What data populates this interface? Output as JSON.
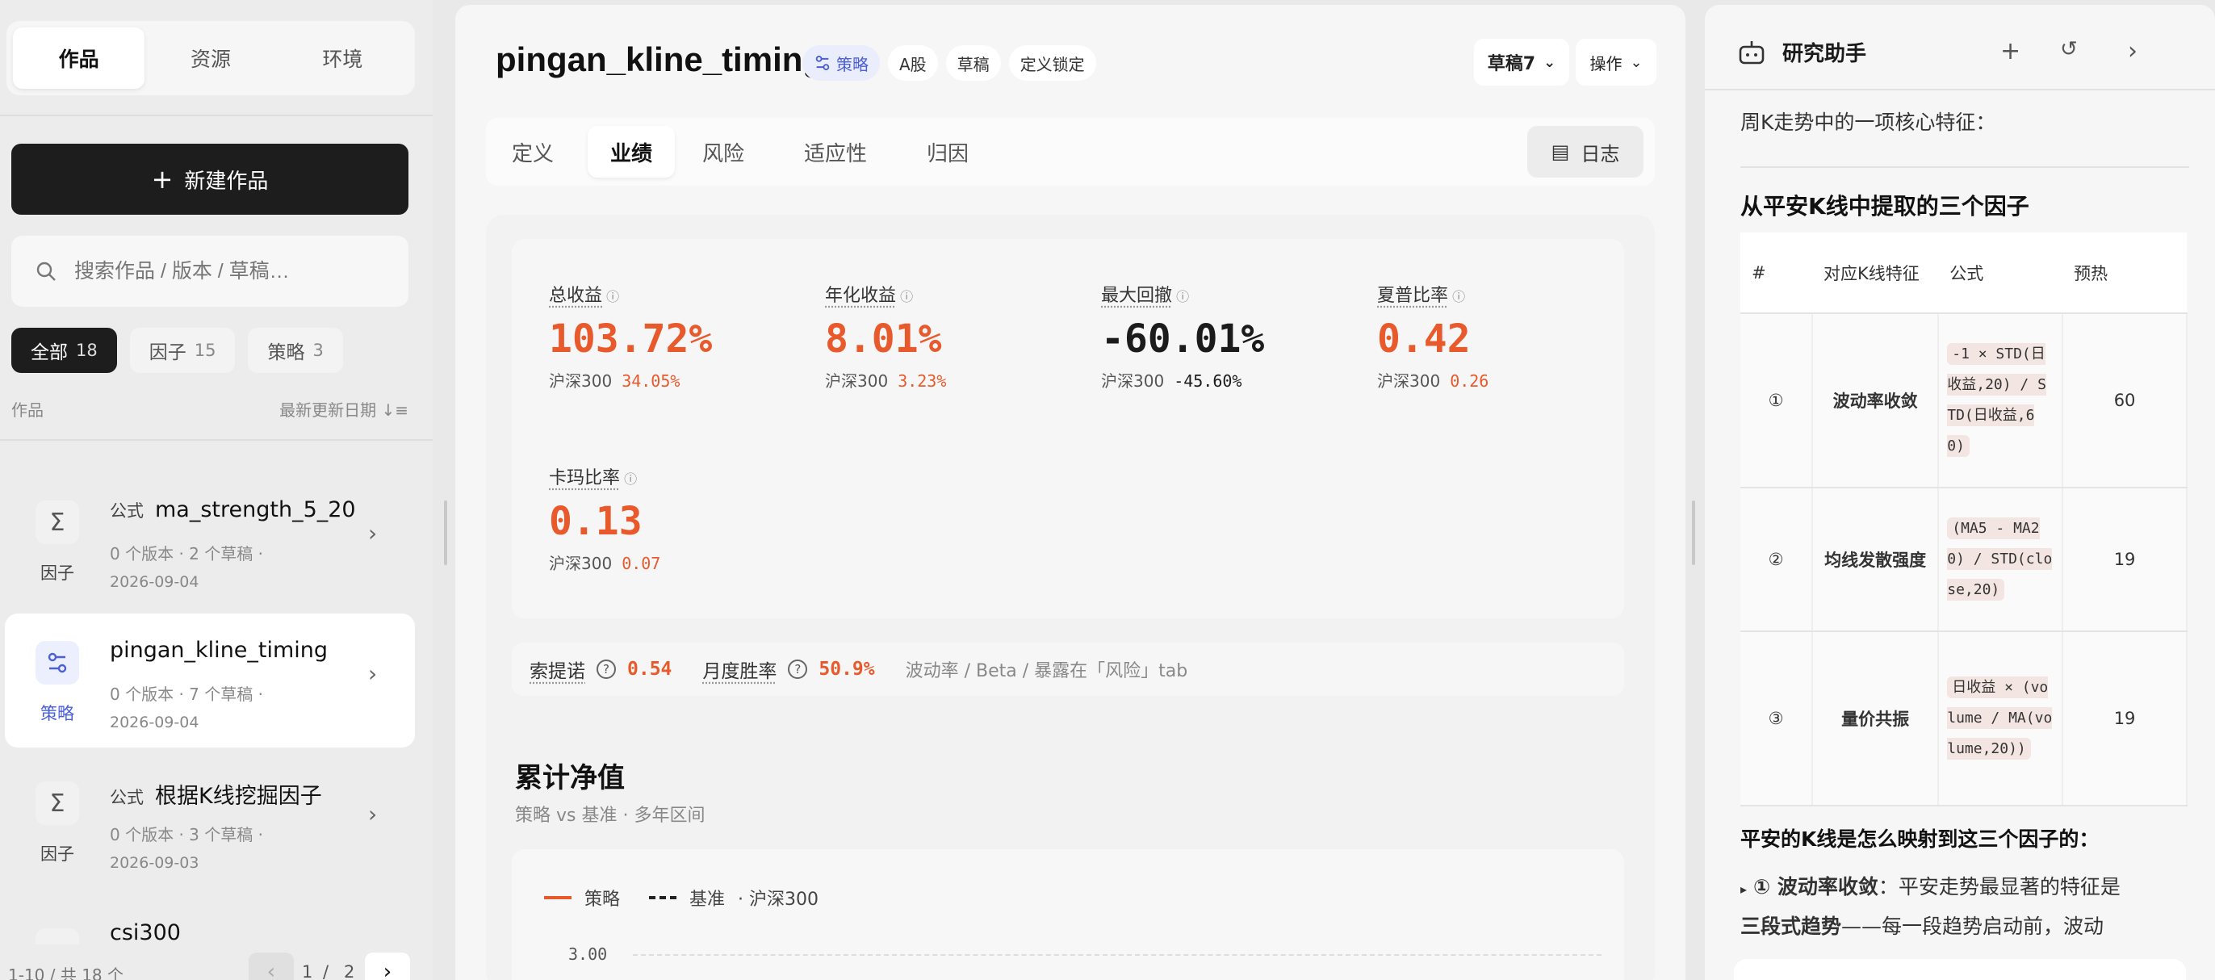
{
  "sidebar": {
    "tabs": [
      "作品",
      "资源",
      "环境"
    ],
    "new_button": "新建作品",
    "search_placeholder": "搜索作品 / 版本 / 草稿…",
    "filters": [
      {
        "label": "全部",
        "count": "18"
      },
      {
        "label": "因子",
        "count": "15"
      },
      {
        "label": "策略",
        "count": "3"
      }
    ],
    "list_header_left": "作品",
    "list_header_right": "最新更新日期",
    "items": [
      {
        "kind": "因子",
        "tag": "公式",
        "title": "ma_strength_5_20",
        "meta": "0 个版本 · 2 个草稿 ·",
        "date": "2026-09-04",
        "icon": "sigma-icon"
      },
      {
        "kind": "策略",
        "tag": "",
        "title": "pingan_kline_timing",
        "meta": "0 个版本 · 7 个草稿 ·",
        "date": "2026-09-04",
        "icon": "strategy-icon"
      },
      {
        "kind": "因子",
        "tag": "公式",
        "title": "根据K线挖掘因子",
        "meta": "0 个版本 · 3 个草稿 ·",
        "date": "2026-09-03",
        "icon": "sigma-icon"
      },
      {
        "kind": "",
        "tag": "",
        "title": "csi300",
        "meta": "",
        "date": "",
        "icon": ""
      }
    ],
    "pager": {
      "info": "1-10 / 共 18 个",
      "page": "1",
      "sep": "/",
      "total": "2"
    }
  },
  "main": {
    "title": "pingan_kline_timing",
    "badges": [
      "策略",
      "A股",
      "草稿",
      "定义锁定"
    ],
    "draft_button": "草稿7",
    "action_button": "操作",
    "tabs": [
      "定义",
      "业绩",
      "风险",
      "适应性",
      "归因"
    ],
    "log_button": "日志",
    "benchmark_name": "沪深300",
    "metrics": [
      {
        "label": "总收益",
        "value": "103.72%",
        "bench": "34.05%",
        "value_color": "#e85a2c",
        "bench_color": "#e85a2c"
      },
      {
        "label": "年化收益",
        "value": "8.01%",
        "bench": "3.23%",
        "value_color": "#e85a2c",
        "bench_color": "#e85a2c"
      },
      {
        "label": "最大回撤",
        "value": "-60.01%",
        "bench": "-45.60%",
        "value_color": "#1b1b1b",
        "bench_color": "#1b1b1b"
      },
      {
        "label": "夏普比率",
        "value": "0.42",
        "bench": "0.26",
        "value_color": "#e85a2c",
        "bench_color": "#e85a2c"
      },
      {
        "label": "卡玛比率",
        "value": "0.13",
        "bench": "0.07",
        "value_color": "#e85a2c",
        "bench_color": "#e85a2c"
      }
    ],
    "sortino_label": "索提诺",
    "sortino_value": "0.54",
    "winrate_label": "月度胜率",
    "winrate_value": "50.9%",
    "ratios_note": "波动率 / Beta / 暴露在「风险」tab",
    "nav_title": "累计净值",
    "nav_subtitle": "策略 vs 基准 · 多年区间",
    "legend_strategy": "策略",
    "legend_benchmark": "基准",
    "legend_benchmark_name": "· 沪深300",
    "y_tick_top": "3.00"
  },
  "assistant": {
    "title": "研究助手",
    "intro": "周K走势中的一项核心特征：",
    "heading": "从平安K线中提取的三个因子",
    "table_headers": [
      "#",
      "对应K线特征",
      "公式",
      "预热"
    ],
    "rows": [
      {
        "num": "①",
        "feature": "波动率收敛",
        "formula": "-1 × STD(日收益,20) / STD(日收益,60)",
        "warmup": "60"
      },
      {
        "num": "②",
        "feature": "均线发散强度",
        "formula": "(MA5 - MA20) / STD(close,20)",
        "warmup": "19"
      },
      {
        "num": "③",
        "feature": "量价共振",
        "formula": "日收益 × (volume / MA(volume,20))",
        "warmup": "19"
      }
    ],
    "mapping_heading": "平安的K线是怎么映射到这三个因子的：",
    "bullet_bold": "① 波动率收敛",
    "bullet_text": "：平安走势最显著的特征是",
    "bullet_bold2": "三段式趋势",
    "bullet_text2": "——每一段趋势启动前，波动"
  },
  "colors": {
    "accent": "#e85a2c",
    "strategy_blue": "#4a5fd8",
    "dark": "#1d1d1d"
  }
}
